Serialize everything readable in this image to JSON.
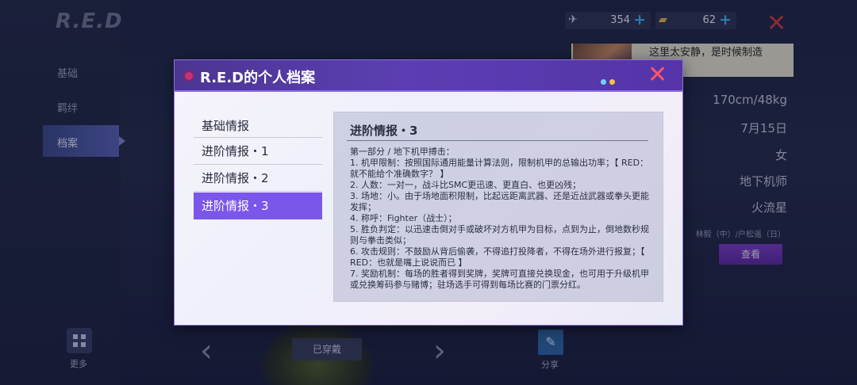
{
  "character": {
    "title": "R.E.D"
  },
  "sidebar": {
    "items": [
      {
        "label": "基础"
      },
      {
        "label": "羁绊"
      },
      {
        "label": "档案"
      }
    ],
    "more_label": "更多"
  },
  "currency": [
    {
      "icon": "plane-icon",
      "value": "354"
    },
    {
      "icon": "ticket-icon",
      "value": "62"
    }
  ],
  "speech_bubble": {
    "text": "这里太安静，是时候制造\n了。"
  },
  "profile_info": {
    "rows": [
      "170cm/48kg",
      "7月15日",
      "女",
      "地下机师",
      "火流星"
    ],
    "voice_actors": "林毅（中）/户松遥（日）",
    "view_button": "查看"
  },
  "bottom": {
    "worn_label": "已穿戴",
    "share_label": "分享"
  },
  "modal": {
    "title": "R.E.D的个人档案",
    "menu": [
      {
        "label": "基础情报",
        "active": false
      },
      {
        "label": "进阶情报・1",
        "active": false
      },
      {
        "label": "进阶情报・2",
        "active": false
      },
      {
        "label": "进阶情报・3",
        "active": true
      }
    ],
    "detail": {
      "title": "进阶情报・3",
      "lines": [
        "第一部分 / 地下机甲搏击：",
        "1. 机甲限制：按照国际通用能量计算法则，限制机甲的总输出功率；【 RED：就不能给个准确数字？ 】",
        "2. 人数：一对一，战斗比SMC更迅速、更直白、也更凶残；",
        "3. 场地：小。由于场地面积限制，比起远距离武器、还是近战武器或拳头更能发挥；",
        "4. 称呼：Fighter（战士）；",
        "5. 胜负判定：以迅速击倒对手或破坏对方机甲为目标，点到为止，倒地数秒规则与拳击类似；",
        "6. 攻击规则：不鼓励从背后偷袭，不得追打投降者，不得在场外进行报复；【 RED：也就是嘴上说说而已 】",
        "7. 奖励机制：每场的胜者得到奖牌，奖牌可直接兑换现金，也可用于升级机甲或兑换筹码参与赌博；驻场选手可得到每场比赛的门票分红。"
      ]
    }
  },
  "colors": {
    "modal_header": "#5b3fb2",
    "active_menu": "#7a56ea",
    "close_red": "#ff5566",
    "currency_plus": "#3fb7ff",
    "view_button": "#6a34b8"
  }
}
